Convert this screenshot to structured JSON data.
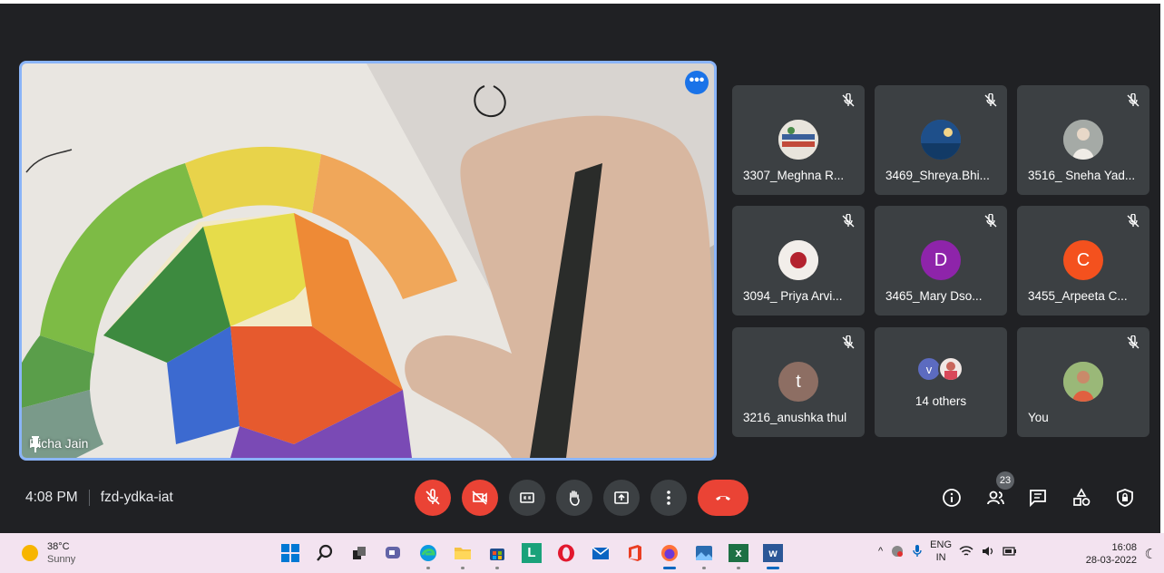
{
  "stage": {
    "presenter_name": "Richa Jain",
    "more_label": "•••"
  },
  "participants": [
    {
      "label": "3307_Meghna R...",
      "avatar_type": "image",
      "avatar_color": "#d8d2c4"
    },
    {
      "label": "3469_Shreya.Bhi...",
      "avatar_type": "image",
      "avatar_color": "#2c6fb5"
    },
    {
      "label": "3516_ Sneha Yad...",
      "avatar_type": "image",
      "avatar_color": "#9aa0a0"
    },
    {
      "label": "3094_ Priya Arvi...",
      "avatar_type": "image",
      "avatar_color": "#efe9e4"
    },
    {
      "label": "3465_Mary Dso...",
      "avatar_type": "letter",
      "letter": "D",
      "avatar_color": "#8e24aa"
    },
    {
      "label": "3455_Arpeeta C...",
      "avatar_type": "letter",
      "letter": "C",
      "avatar_color": "#f4511e"
    },
    {
      "label": "3216_anushka thul",
      "avatar_type": "letter",
      "letter": "t",
      "avatar_color": "#8d6e63"
    },
    {
      "label": "14 others",
      "avatar_type": "group",
      "letter": "v",
      "avatar_color": "#5c6bc0"
    },
    {
      "label": "You",
      "avatar_type": "image",
      "avatar_color": "#a8c08a"
    }
  ],
  "meeting": {
    "time": "4:08 PM",
    "code": "fzd-ydka-iat",
    "participant_count": "23"
  },
  "taskbar": {
    "temperature": "38°C",
    "condition": "Sunny",
    "lang_top": "ENG",
    "lang_bottom": "IN",
    "time": "16:08",
    "date": "28-03-2022"
  },
  "colors": {
    "accent": "#8ab4f8",
    "danger": "#ea4335",
    "surface": "#3c4043",
    "background": "#202124"
  }
}
